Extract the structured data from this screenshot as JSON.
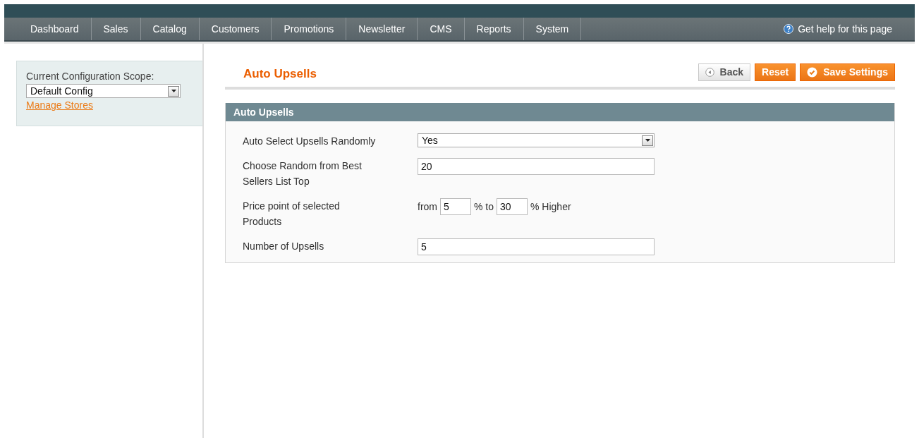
{
  "nav": {
    "items": [
      "Dashboard",
      "Sales",
      "Catalog",
      "Customers",
      "Promotions",
      "Newsletter",
      "CMS",
      "Reports",
      "System"
    ],
    "help": "Get help for this page"
  },
  "sidebar": {
    "scope_label": "Current Configuration Scope:",
    "scope_value": "Default Config",
    "manage_link": "Manage Stores"
  },
  "page": {
    "title": "Auto Upsells",
    "buttons": [
      {
        "label": "Back",
        "kind": "back"
      },
      {
        "label": "Reset",
        "kind": "reset"
      },
      {
        "label": "Save Settings",
        "kind": "save"
      }
    ]
  },
  "section": {
    "title": "Auto Upsells",
    "rows": [
      {
        "kind": "select",
        "label": "Auto Select Upsells Randomly",
        "value": "Yes"
      },
      {
        "kind": "text",
        "label": "Choose Random from Best Sellers List Top",
        "value": "20"
      },
      {
        "kind": "range",
        "label": "Price point of selected Products",
        "prefix": "from",
        "from": "5",
        "middle": "% to",
        "to": "30",
        "suffix": "% Higher"
      },
      {
        "kind": "text",
        "label": "Number of Upsells",
        "value": "5"
      }
    ]
  }
}
